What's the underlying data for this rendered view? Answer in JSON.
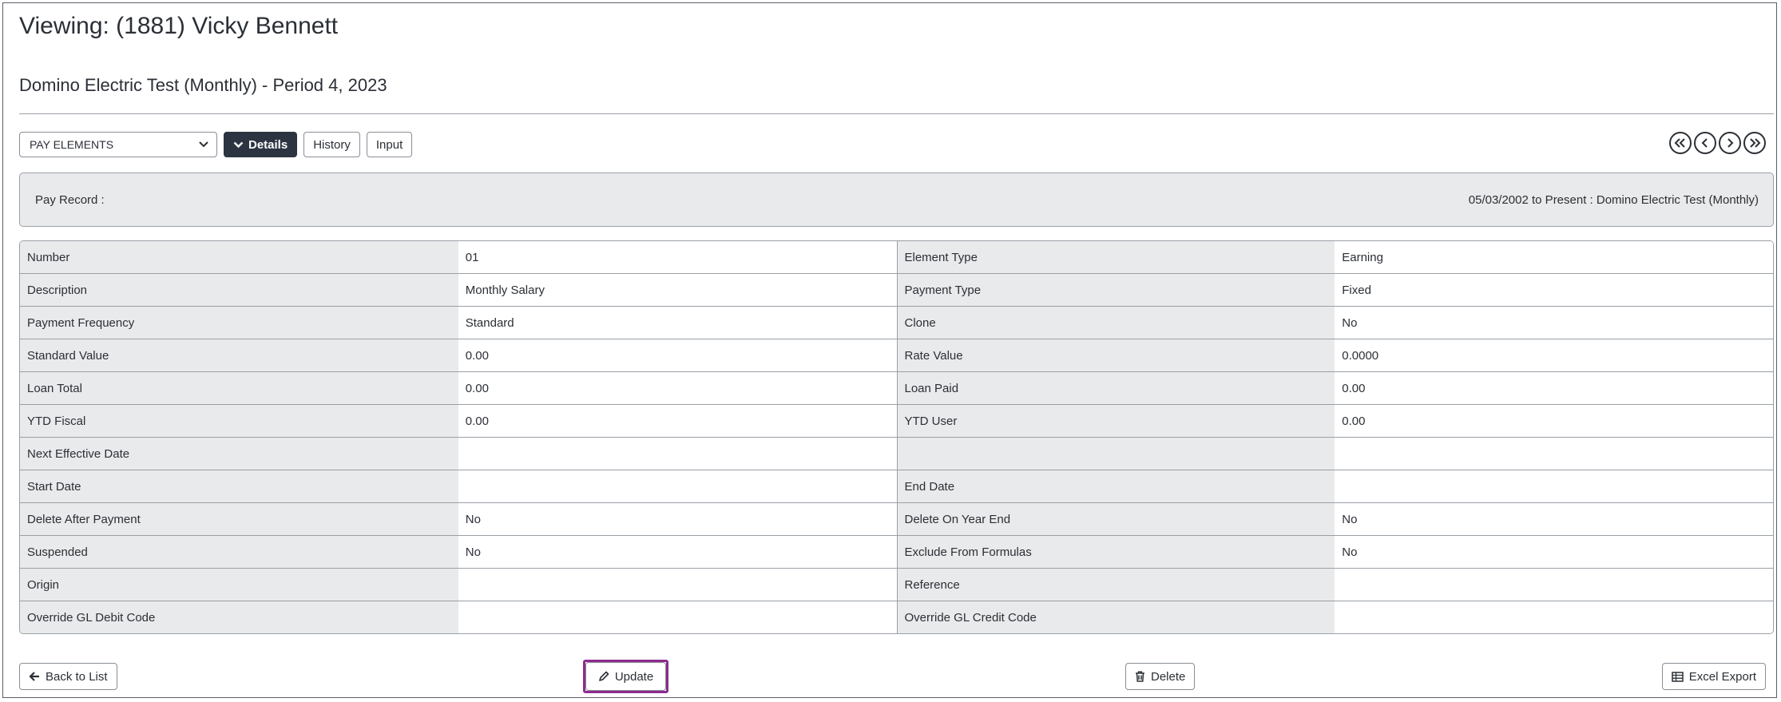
{
  "header": {
    "title": "Viewing: (1881) Vicky Bennett",
    "subtitle": "Domino Electric Test (Monthly) - Period 4, 2023"
  },
  "toolbar": {
    "select_value": "PAY ELEMENTS",
    "details_label": "Details",
    "history_label": "History",
    "input_label": "Input"
  },
  "pay_record": {
    "label": "Pay Record :",
    "value": "05/03/2002 to Present : Domino Electric Test (Monthly)"
  },
  "details": [
    [
      "Number",
      "01",
      "Element Type",
      "Earning"
    ],
    [
      "Description",
      "Monthly Salary",
      "Payment Type",
      "Fixed"
    ],
    [
      "Payment Frequency",
      "Standard",
      "Clone",
      "No"
    ],
    [
      "Standard Value",
      "0.00",
      "Rate Value",
      "0.0000"
    ],
    [
      "Loan Total",
      "0.00",
      "Loan Paid",
      "0.00"
    ],
    [
      "YTD Fiscal",
      "0.00",
      "YTD User",
      "0.00"
    ],
    [
      "Next Effective Date",
      "",
      "",
      ""
    ],
    [
      "Start Date",
      "",
      "End Date",
      ""
    ],
    [
      "Delete After Payment",
      "No",
      "Delete On Year End",
      "No"
    ],
    [
      "Suspended",
      "No",
      "Exclude From Formulas",
      "No"
    ],
    [
      "Origin",
      "",
      "Reference",
      ""
    ],
    [
      "Override GL Debit Code",
      "",
      "Override GL Credit Code",
      ""
    ]
  ],
  "footer": {
    "back_label": "Back to List",
    "update_label": "Update",
    "delete_label": "Delete",
    "export_label": "Excel Export"
  },
  "colors": {
    "dark_button": "#2b3440",
    "focus_outline": "#8e2b8e",
    "label_bg": "#e9eaeb"
  }
}
